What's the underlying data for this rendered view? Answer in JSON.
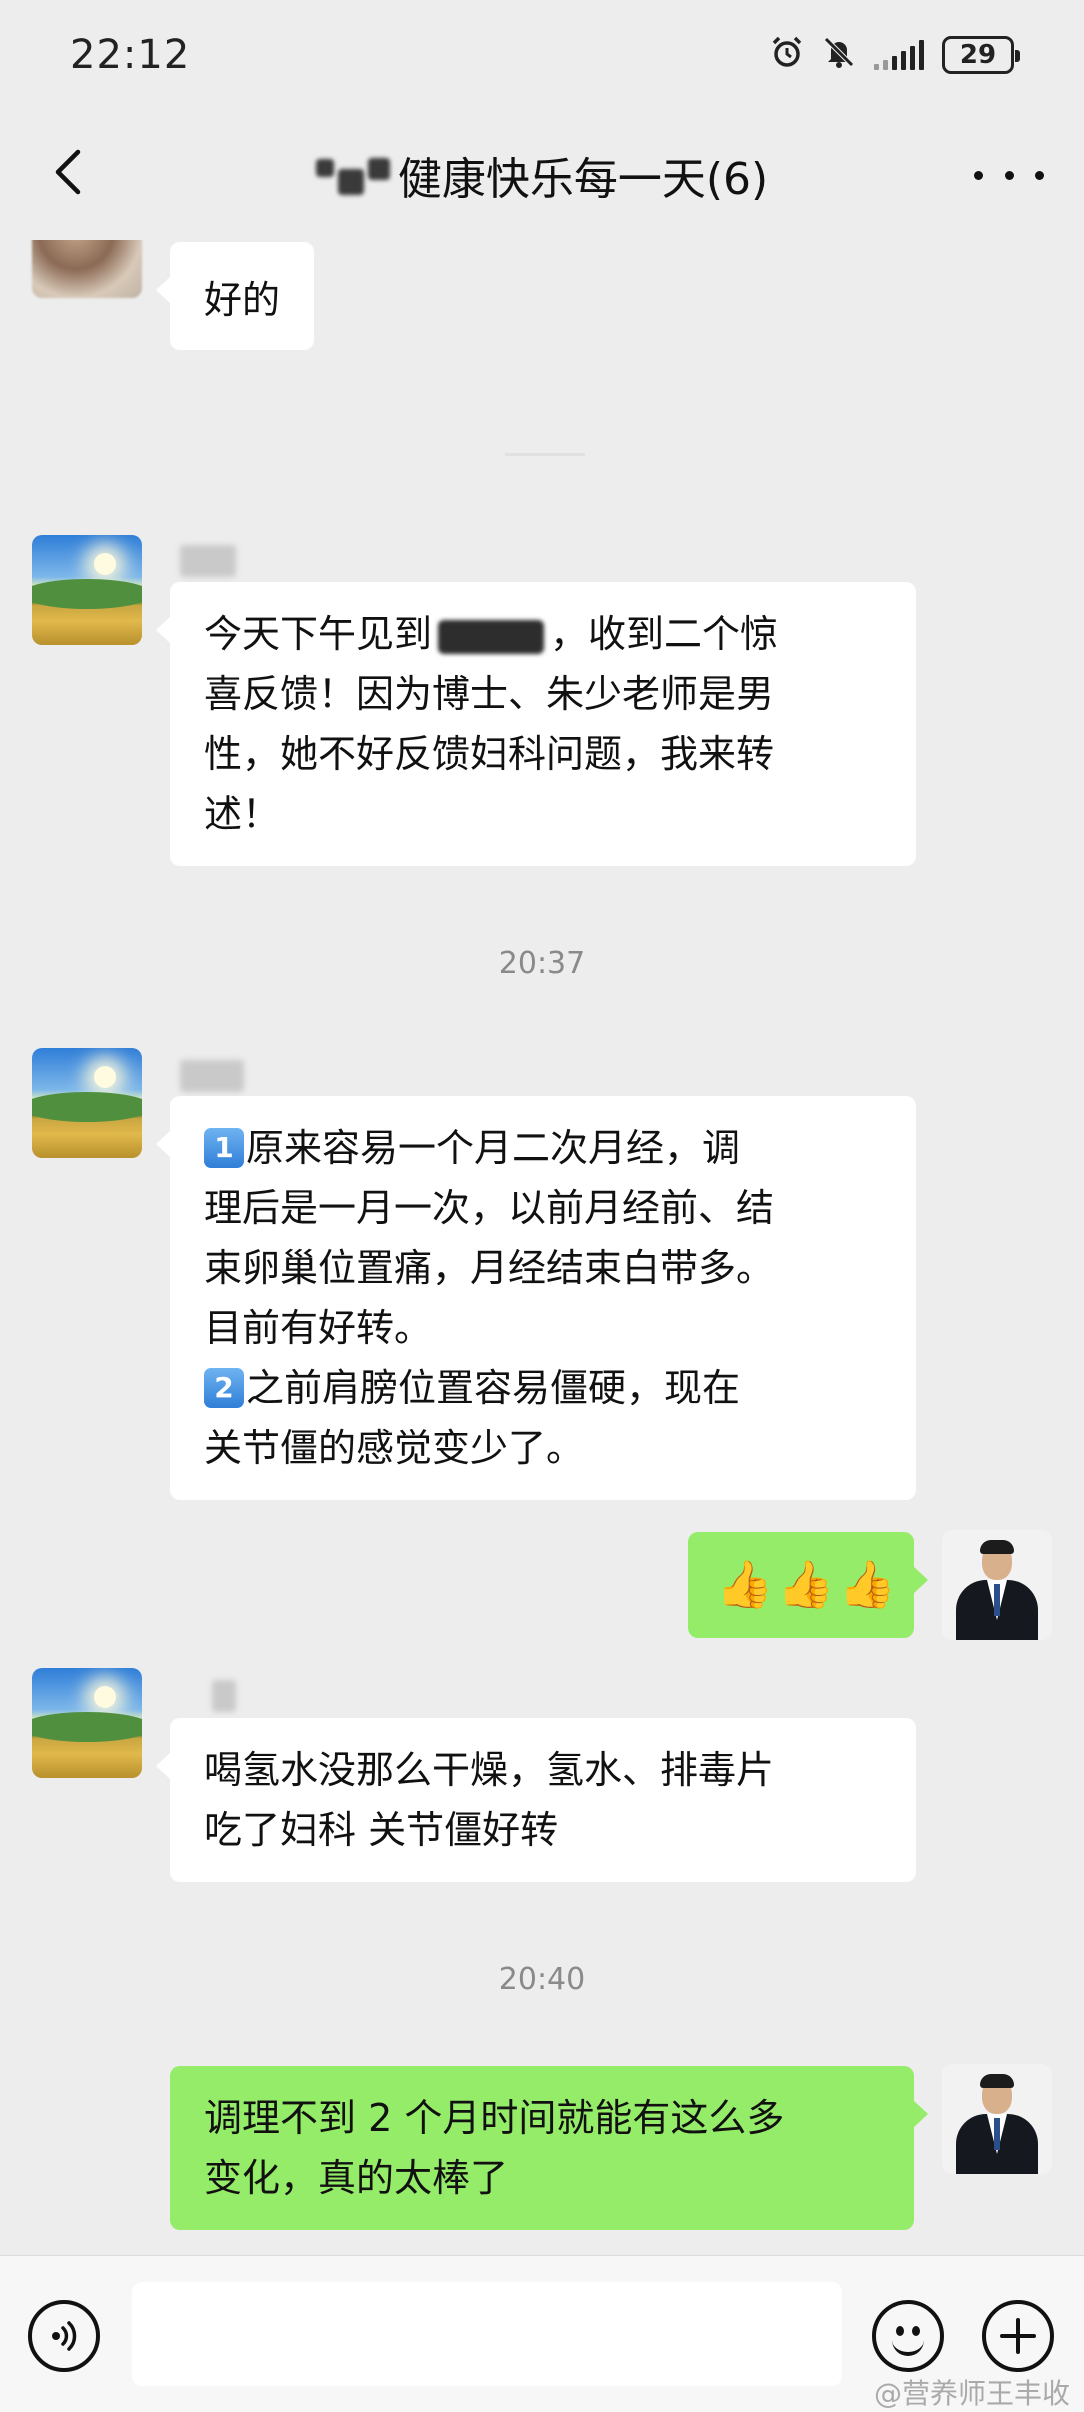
{
  "status_bar": {
    "time": "22:12",
    "battery": "29",
    "icons": [
      "alarm-icon",
      "mute-icon",
      "signal-icon",
      "battery-icon"
    ]
  },
  "header": {
    "title": "健康快乐每一天(6)",
    "back_icon": "chevron-left-icon",
    "more_icon": "more-dots-icon"
  },
  "messages": [
    {
      "side": "left",
      "avatar": "cropped-photo",
      "lines": [
        "好的"
      ]
    },
    {
      "side": "left",
      "avatar": "landscape",
      "lines": [
        "今天下午见到",
        "，收到二个惊",
        "喜反馈！因为博士、朱少老师是男",
        "性，她不好反馈妇科问题，我来转",
        "述！"
      ]
    },
    {
      "type": "time",
      "text": "20:37"
    },
    {
      "side": "left",
      "avatar": "landscape",
      "lines": [
        "1",
        "原来容易一个月二次月经，调",
        "理后是一月一次，以前月经前、结",
        "束卵巢位置痛，月经结束白带多。",
        "目前有好转。",
        "2",
        "之前肩膀位置容易僵硬，现在",
        "关节僵的感觉变少了。"
      ]
    },
    {
      "side": "right",
      "avatar": "person-in-suit",
      "lines": [
        "👍👍👍"
      ]
    },
    {
      "side": "left",
      "avatar": "landscape",
      "lines": [
        "喝氢水没那么干燥，氢水、排毒片",
        "吃了妇科 关节僵好转"
      ]
    },
    {
      "type": "time",
      "text": "20:40"
    },
    {
      "side": "right",
      "avatar": "person-in-suit",
      "lines": [
        "调理不到 2 个月时间就能有这么多",
        "变化，真的太棒了"
      ]
    }
  ],
  "input_bar": {
    "placeholder": "",
    "voice_icon": "voice-icon",
    "emoji_icon": "emoji-icon",
    "plus_icon": "plus-icon"
  },
  "watermark": "@营养师王丰收",
  "colors": {
    "background": "#EDEDED",
    "bubble_left": "#FFFFFF",
    "bubble_right": "#95EC69",
    "timestamp": "#8A8A8A"
  }
}
